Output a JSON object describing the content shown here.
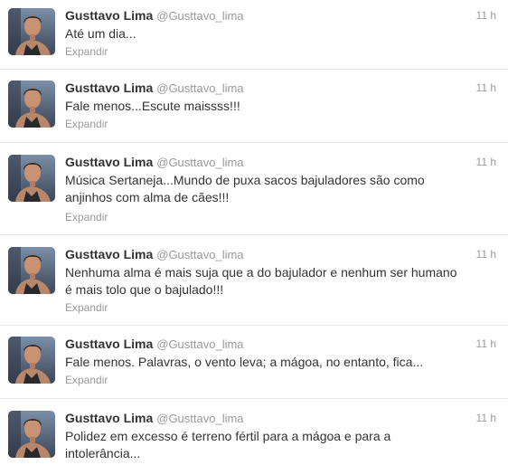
{
  "tweets": [
    {
      "name": "Gusttavo Lima",
      "handle": "@Gusttavo_lima",
      "time": "11 h",
      "text": "Até um dia...",
      "expand": "Expandir"
    },
    {
      "name": "Gusttavo Lima",
      "handle": "@Gusttavo_lima",
      "time": "11 h",
      "text": "Fale menos...Escute maissss!!!",
      "expand": "Expandir"
    },
    {
      "name": "Gusttavo Lima",
      "handle": "@Gusttavo_lima",
      "time": "11 h",
      "text_line1": "Música Sertaneja...Mundo de puxa sacos bajuladores são como",
      "text_line2": "anjinhos com alma de cães!!!",
      "expand": "Expandir"
    },
    {
      "name": "Gusttavo Lima",
      "handle": "@Gusttavo_lima",
      "time": "11 h",
      "text_line1": "Nenhuma alma é mais suja que a do bajulador e nenhum ser humano",
      "text_line2": "é mais tolo que o bajulado!!!",
      "expand": "Expandir"
    },
    {
      "name": "Gusttavo Lima",
      "handle": "@Gusttavo_lima",
      "time": "11 h",
      "text": "Fale menos. Palavras, o vento leva; a mágoa, no entanto, fica...",
      "expand": "Expandir"
    },
    {
      "name": "Gusttavo Lima",
      "handle": "@Gusttavo_lima",
      "time": "11 h",
      "text_line1": "Polidez em excesso é terreno fértil para a mágoa e para a",
      "text_line2": "intolerância..."
    }
  ],
  "colors": {
    "name": "#333333",
    "meta": "#999999",
    "divider": "#e8e8e8"
  },
  "icons": {
    "avatar": "profile-photo"
  }
}
